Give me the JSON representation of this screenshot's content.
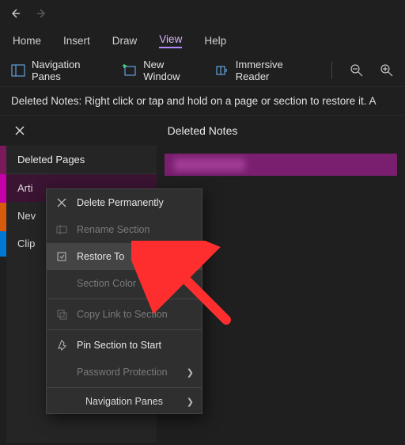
{
  "menu": {
    "home": "Home",
    "insert": "Insert",
    "draw": "Draw",
    "view": "View",
    "help": "Help"
  },
  "ribbon": {
    "nav_panes": "Navigation Panes",
    "new_window": "New Window",
    "immersive": "Immersive Reader"
  },
  "info": "Deleted Notes: Right click or tap and hold on a page or section to restore it. A",
  "header": {
    "title": "Deleted Notes"
  },
  "sections": {
    "head": "Deleted Pages",
    "items": [
      "Arti",
      "Nev",
      "Clip"
    ]
  },
  "ctx": {
    "delete_perm": "Delete Permanently",
    "rename": "Rename Section",
    "restore": "Restore To",
    "color": "Section Color",
    "copy_link": "Copy Link to Section",
    "pin": "Pin Section to Start",
    "password": "Password Protection",
    "nav_panes": "Navigation Panes"
  }
}
